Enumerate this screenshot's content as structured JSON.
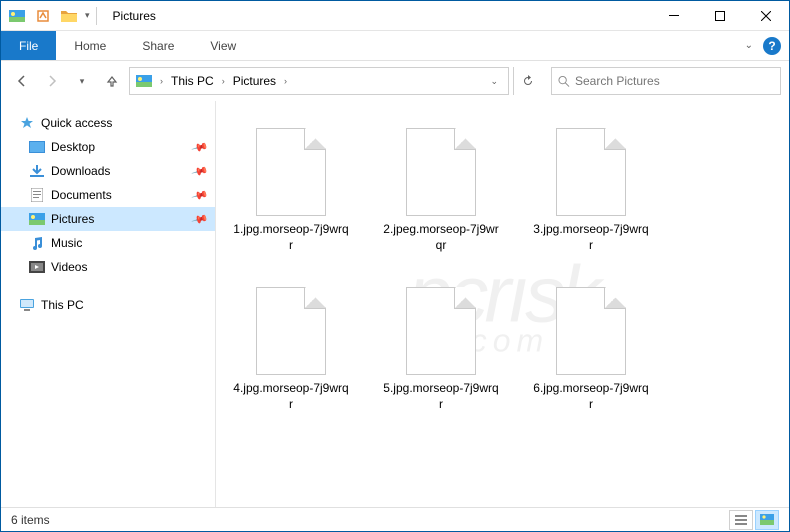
{
  "window": {
    "title": "Pictures"
  },
  "ribbon": {
    "file": "File",
    "tabs": [
      "Home",
      "Share",
      "View"
    ]
  },
  "breadcrumb": {
    "root": "This PC",
    "current": "Pictures"
  },
  "search": {
    "placeholder": "Search Pictures"
  },
  "nav": {
    "quick_access": "Quick access",
    "items": [
      {
        "label": "Desktop",
        "pinned": true
      },
      {
        "label": "Downloads",
        "pinned": true
      },
      {
        "label": "Documents",
        "pinned": true
      },
      {
        "label": "Pictures",
        "pinned": true,
        "selected": true
      },
      {
        "label": "Music",
        "pinned": false
      },
      {
        "label": "Videos",
        "pinned": false
      }
    ],
    "this_pc": "This PC"
  },
  "files": [
    {
      "name": "1.jpg.morseop-7j9wrqr"
    },
    {
      "name": "2.jpeg.morseop-7j9wrqr"
    },
    {
      "name": "3.jpg.morseop-7j9wrqr"
    },
    {
      "name": "4.jpg.morseop-7j9wrqr"
    },
    {
      "name": "5.jpg.morseop-7j9wrqr"
    },
    {
      "name": "6.jpg.morseop-7j9wrqr"
    }
  ],
  "status": {
    "count_label": "6 items"
  },
  "watermark": {
    "main": "pcrısk",
    "sub": ".com"
  }
}
